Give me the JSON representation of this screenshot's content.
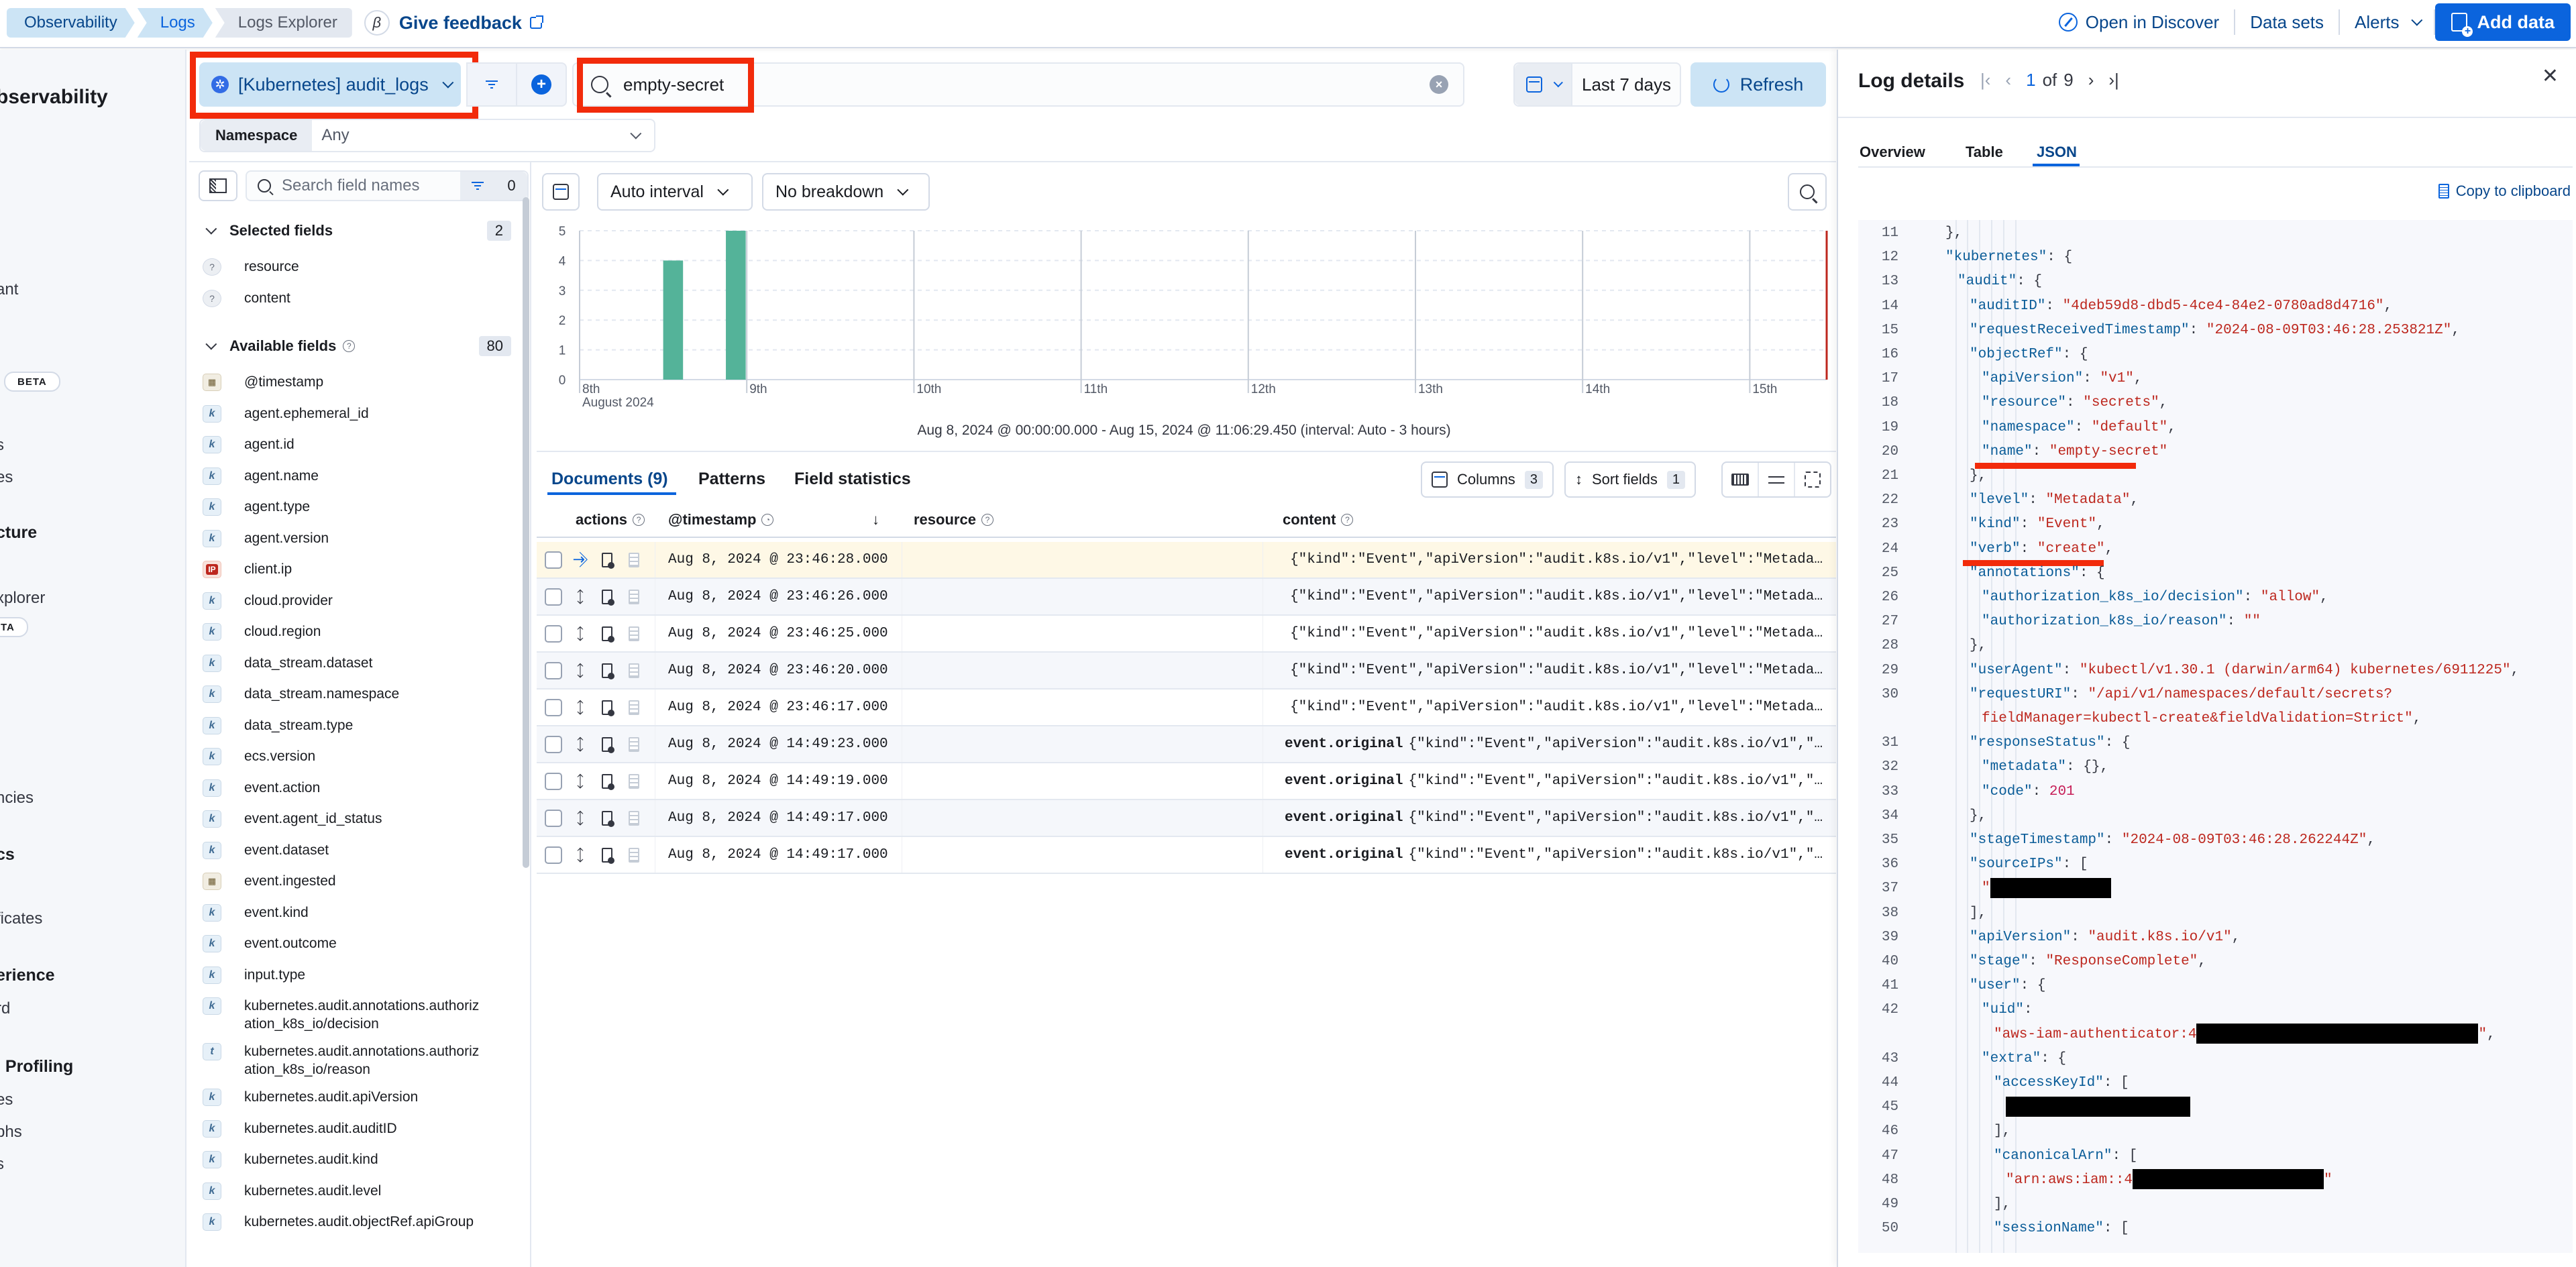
{
  "header": {
    "breadcrumbs": [
      "Observability",
      "Logs",
      "Logs Explorer"
    ],
    "beta_glyph": "β",
    "feedback_label": "Give feedback",
    "open_in_discover": "Open in Discover",
    "data_sets": "Data sets",
    "alerts": "Alerts",
    "add_data": "Add data"
  },
  "leftnav": {
    "title_fragment": "bservability",
    "fragments": [
      {
        "text": "ant",
        "bold": false
      },
      {
        "text": "BETA",
        "badge": true
      },
      {
        "text": "s",
        "bold": false
      },
      {
        "text": "es",
        "bold": false
      },
      {
        "text": "cture",
        "bold": true
      },
      {
        "text": "xplorer",
        "bold": false
      },
      {
        "text": "ETA",
        "badge": true
      },
      {
        "text": "ncies",
        "bold": false
      },
      {
        "text": "cs",
        "bold": true
      },
      {
        "text": "ficates",
        "bold": false
      },
      {
        "text": "erience",
        "bold": true
      },
      {
        "text": "rd",
        "bold": false
      },
      {
        "text": "l Profiling",
        "bold": true
      },
      {
        "text": "es",
        "bold": false
      },
      {
        "text": "phs",
        "bold": false
      },
      {
        "text": "s",
        "bold": false
      }
    ]
  },
  "querybar": {
    "dataview": "[Kubernetes] audit_logs",
    "query": "empty-secret",
    "date_range": "Last 7 days",
    "refresh": "Refresh",
    "namespace_label": "Namespace",
    "namespace_value": "Any"
  },
  "fields": {
    "search_placeholder": "Search field names",
    "filter_count": "0",
    "selected_title": "Selected fields",
    "selected_count": "2",
    "selected": [
      {
        "type": "unknown",
        "name": "resource"
      },
      {
        "type": "unknown",
        "name": "content"
      }
    ],
    "available_title": "Available fields",
    "available_count": "80",
    "available": [
      {
        "type": "date",
        "name": "@timestamp"
      },
      {
        "type": "keyword",
        "name": "agent.ephemeral_id"
      },
      {
        "type": "keyword",
        "name": "agent.id"
      },
      {
        "type": "keyword",
        "name": "agent.name"
      },
      {
        "type": "keyword",
        "name": "agent.type"
      },
      {
        "type": "keyword",
        "name": "agent.version"
      },
      {
        "type": "ip",
        "name": "client.ip"
      },
      {
        "type": "keyword",
        "name": "cloud.provider"
      },
      {
        "type": "keyword",
        "name": "cloud.region"
      },
      {
        "type": "keyword",
        "name": "data_stream.dataset"
      },
      {
        "type": "keyword",
        "name": "data_stream.namespace"
      },
      {
        "type": "keyword",
        "name": "data_stream.type"
      },
      {
        "type": "keyword",
        "name": "ecs.version"
      },
      {
        "type": "keyword",
        "name": "event.action"
      },
      {
        "type": "keyword",
        "name": "event.agent_id_status"
      },
      {
        "type": "keyword",
        "name": "event.dataset"
      },
      {
        "type": "date",
        "name": "event.ingested"
      },
      {
        "type": "keyword",
        "name": "event.kind"
      },
      {
        "type": "keyword",
        "name": "event.outcome"
      },
      {
        "type": "keyword",
        "name": "input.type"
      },
      {
        "type": "keyword",
        "name": "kubernetes.audit.annotations.authorization_k8s_io/decision"
      },
      {
        "type": "text",
        "name": "kubernetes.audit.annotations.authorization_k8s_io/reason"
      },
      {
        "type": "keyword",
        "name": "kubernetes.audit.apiVersion"
      },
      {
        "type": "keyword",
        "name": "kubernetes.audit.auditID"
      },
      {
        "type": "keyword",
        "name": "kubernetes.audit.kind"
      },
      {
        "type": "keyword",
        "name": "kubernetes.audit.level"
      },
      {
        "type": "keyword",
        "name": "kubernetes.audit.objectRef.apiGroup"
      }
    ]
  },
  "histogram": {
    "interval_label": "Auto interval",
    "breakdown_label": "No breakdown",
    "caption": "Aug 8, 2024 @ 00:00:00.000 - Aug 15, 2024 @ 11:06:29.450 (interval: Auto - 3 hours)"
  },
  "chart_data": {
    "type": "bar",
    "title": "",
    "xlabel": "",
    "ylabel": "",
    "ylim": [
      0,
      5
    ],
    "yticks": [
      "0",
      "1",
      "2",
      "3",
      "4",
      "5"
    ],
    "x_range_days": [
      8,
      15.46
    ],
    "x_ticks": [
      {
        "day": 8,
        "label": "8th",
        "sublabel": "August 2024"
      },
      {
        "day": 9,
        "label": "9th"
      },
      {
        "day": 10,
        "label": "10th"
      },
      {
        "day": 11,
        "label": "11th"
      },
      {
        "day": 12,
        "label": "12th"
      },
      {
        "day": 13,
        "label": "13th"
      },
      {
        "day": 14,
        "label": "14th"
      },
      {
        "day": 15,
        "label": "15th"
      }
    ],
    "interval_hours": 3,
    "bars": [
      {
        "bucket_start": "Aug 8, 2024 12:00",
        "day_offset": 8.5,
        "value": 4
      },
      {
        "bucket_start": "Aug 8, 2024 21:00",
        "day_offset": 8.875,
        "value": 5
      }
    ],
    "now_marker_day": 15.46,
    "bar_color": "#54b399",
    "grid": true
  },
  "documents": {
    "tabs": [
      "Documents (9)",
      "Patterns",
      "Field statistics"
    ],
    "columns_label": "Columns",
    "columns_count": "3",
    "sort_label": "Sort fields",
    "sort_count": "1",
    "headers": {
      "actions": "actions",
      "timestamp": "@timestamp",
      "resource": "resource",
      "content": "content"
    },
    "rows": [
      {
        "timestamp": "Aug 8, 2024 @ 23:46:28.000",
        "content_key": "",
        "content": "{\"kind\":\"Event\",\"apiVersion\":\"audit.k8s.io/v1\",\"level\":\"Metada…",
        "selected": true
      },
      {
        "timestamp": "Aug 8, 2024 @ 23:46:26.000",
        "content_key": "",
        "content": "{\"kind\":\"Event\",\"apiVersion\":\"audit.k8s.io/v1\",\"level\":\"Metada…"
      },
      {
        "timestamp": "Aug 8, 2024 @ 23:46:25.000",
        "content_key": "",
        "content": "{\"kind\":\"Event\",\"apiVersion\":\"audit.k8s.io/v1\",\"level\":\"Metada…"
      },
      {
        "timestamp": "Aug 8, 2024 @ 23:46:20.000",
        "content_key": "",
        "content": "{\"kind\":\"Event\",\"apiVersion\":\"audit.k8s.io/v1\",\"level\":\"Metada…"
      },
      {
        "timestamp": "Aug 8, 2024 @ 23:46:17.000",
        "content_key": "",
        "content": "{\"kind\":\"Event\",\"apiVersion\":\"audit.k8s.io/v1\",\"level\":\"Metada…"
      },
      {
        "timestamp": "Aug 8, 2024 @ 14:49:23.000",
        "content_key": "event.original",
        "content": "{\"kind\":\"Event\",\"apiVersion\":\"audit.k8s.io/v1\",\"…"
      },
      {
        "timestamp": "Aug 8, 2024 @ 14:49:19.000",
        "content_key": "event.original",
        "content": "{\"kind\":\"Event\",\"apiVersion\":\"audit.k8s.io/v1\",\"…"
      },
      {
        "timestamp": "Aug 8, 2024 @ 14:49:17.000",
        "content_key": "event.original",
        "content": "{\"kind\":\"Event\",\"apiVersion\":\"audit.k8s.io/v1\",\"…"
      },
      {
        "timestamp": "Aug 8, 2024 @ 14:49:17.000",
        "content_key": "event.original",
        "content": "{\"kind\":\"Event\",\"apiVersion\":\"audit.k8s.io/v1\",\"…"
      }
    ]
  },
  "flyout": {
    "title": "Log details",
    "page_current": "1",
    "page_of": "of",
    "page_total": "9",
    "tabs": [
      "Overview",
      "Table",
      "JSON"
    ],
    "active_tab": "JSON",
    "copy_label": "Copy to clipboard",
    "json_lines": [
      {
        "n": "11",
        "indent": 1,
        "parts": [
          [
            "p",
            "},"
          ]
        ]
      },
      {
        "n": "12",
        "indent": 1,
        "parts": [
          [
            "k",
            "\"kubernetes\""
          ],
          [
            "p",
            ": {"
          ]
        ]
      },
      {
        "n": "13",
        "indent": 2,
        "parts": [
          [
            "k",
            "\"audit\""
          ],
          [
            "p",
            ": {"
          ]
        ]
      },
      {
        "n": "14",
        "indent": 3,
        "parts": [
          [
            "k",
            "\"auditID\""
          ],
          [
            "p",
            ": "
          ],
          [
            "s",
            "\"4deb59d8-dbd5-4ce4-84e2-0780ad8d4716\""
          ],
          [
            "p",
            ","
          ]
        ]
      },
      {
        "n": "15",
        "indent": 3,
        "parts": [
          [
            "k",
            "\"requestReceivedTimestamp\""
          ],
          [
            "p",
            ": "
          ],
          [
            "s",
            "\"2024-08-09T03:46:28.253821Z\""
          ],
          [
            "p",
            ","
          ]
        ]
      },
      {
        "n": "16",
        "indent": 3,
        "parts": [
          [
            "k",
            "\"objectRef\""
          ],
          [
            "p",
            ": {"
          ]
        ]
      },
      {
        "n": "17",
        "indent": 4,
        "parts": [
          [
            "k",
            "\"apiVersion\""
          ],
          [
            "p",
            ": "
          ],
          [
            "s",
            "\"v1\""
          ],
          [
            "p",
            ","
          ]
        ]
      },
      {
        "n": "18",
        "indent": 4,
        "parts": [
          [
            "k",
            "\"resource\""
          ],
          [
            "p",
            ": "
          ],
          [
            "s",
            "\"secrets\""
          ],
          [
            "p",
            ","
          ]
        ]
      },
      {
        "n": "19",
        "indent": 4,
        "parts": [
          [
            "k",
            "\"namespace\""
          ],
          [
            "p",
            ": "
          ],
          [
            "s",
            "\"default\""
          ],
          [
            "p",
            ","
          ]
        ]
      },
      {
        "n": "20",
        "indent": 4,
        "parts": [
          [
            "k",
            "\"name\""
          ],
          [
            "p",
            ": "
          ],
          [
            "s",
            "\"empty-secret\""
          ]
        ],
        "highlight": true
      },
      {
        "n": "21",
        "indent": 3,
        "parts": [
          [
            "p",
            "},"
          ]
        ]
      },
      {
        "n": "22",
        "indent": 3,
        "parts": [
          [
            "k",
            "\"level\""
          ],
          [
            "p",
            ": "
          ],
          [
            "s",
            "\"Metadata\""
          ],
          [
            "p",
            ","
          ]
        ]
      },
      {
        "n": "23",
        "indent": 3,
        "parts": [
          [
            "k",
            "\"kind\""
          ],
          [
            "p",
            ": "
          ],
          [
            "s",
            "\"Event\""
          ],
          [
            "p",
            ","
          ]
        ]
      },
      {
        "n": "24",
        "indent": 3,
        "parts": [
          [
            "k",
            "\"verb\""
          ],
          [
            "p",
            ": "
          ],
          [
            "s",
            "\"create\""
          ],
          [
            "p",
            ","
          ]
        ],
        "highlight": true
      },
      {
        "n": "25",
        "indent": 3,
        "parts": [
          [
            "k",
            "\"annotations\""
          ],
          [
            "p",
            ": {"
          ]
        ]
      },
      {
        "n": "26",
        "indent": 4,
        "parts": [
          [
            "k",
            "\"authorization_k8s_io/decision\""
          ],
          [
            "p",
            ": "
          ],
          [
            "s",
            "\"allow\""
          ],
          [
            "p",
            ","
          ]
        ]
      },
      {
        "n": "27",
        "indent": 4,
        "parts": [
          [
            "k",
            "\"authorization_k8s_io/reason\""
          ],
          [
            "p",
            ": "
          ],
          [
            "s",
            "\"\""
          ]
        ]
      },
      {
        "n": "28",
        "indent": 3,
        "parts": [
          [
            "p",
            "},"
          ]
        ]
      },
      {
        "n": "29",
        "indent": 3,
        "parts": [
          [
            "k",
            "\"userAgent\""
          ],
          [
            "p",
            ": "
          ],
          [
            "s",
            "\"kubectl/v1.30.1 (darwin/arm64) kubernetes/6911225\""
          ],
          [
            "p",
            ","
          ]
        ]
      },
      {
        "n": "30",
        "indent": 3,
        "parts": [
          [
            "k",
            "\"requestURI\""
          ],
          [
            "p",
            ": "
          ],
          [
            "s",
            "\"/api/v1/namespaces/default/secrets?"
          ]
        ]
      },
      {
        "n": "",
        "indent": 4,
        "parts": [
          [
            "s",
            "fieldManager=kubectl-create&fieldValidation=Strict\""
          ],
          [
            "p",
            ","
          ]
        ]
      },
      {
        "n": "31",
        "indent": 3,
        "parts": [
          [
            "k",
            "\"responseStatus\""
          ],
          [
            "p",
            ": {"
          ]
        ]
      },
      {
        "n": "32",
        "indent": 4,
        "parts": [
          [
            "k",
            "\"metadata\""
          ],
          [
            "p",
            ": {},"
          ]
        ]
      },
      {
        "n": "33",
        "indent": 4,
        "parts": [
          [
            "k",
            "\"code\""
          ],
          [
            "p",
            ": "
          ],
          [
            "n",
            "201"
          ]
        ]
      },
      {
        "n": "34",
        "indent": 3,
        "parts": [
          [
            "p",
            "},"
          ]
        ]
      },
      {
        "n": "35",
        "indent": 3,
        "parts": [
          [
            "k",
            "\"stageTimestamp\""
          ],
          [
            "p",
            ": "
          ],
          [
            "s",
            "\"2024-08-09T03:46:28.262244Z\""
          ],
          [
            "p",
            ","
          ]
        ]
      },
      {
        "n": "36",
        "indent": 3,
        "parts": [
          [
            "k",
            "\"sourceIPs\""
          ],
          [
            "p",
            ": ["
          ]
        ]
      },
      {
        "n": "37",
        "indent": 4,
        "parts": [
          [
            "s",
            "\""
          ],
          [
            "redact",
            "180"
          ]
        ]
      },
      {
        "n": "38",
        "indent": 3,
        "parts": [
          [
            "p",
            "],"
          ]
        ]
      },
      {
        "n": "39",
        "indent": 3,
        "parts": [
          [
            "k",
            "\"apiVersion\""
          ],
          [
            "p",
            ": "
          ],
          [
            "s",
            "\"audit.k8s.io/v1\""
          ],
          [
            "p",
            ","
          ]
        ]
      },
      {
        "n": "40",
        "indent": 3,
        "parts": [
          [
            "k",
            "\"stage\""
          ],
          [
            "p",
            ": "
          ],
          [
            "s",
            "\"ResponseComplete\""
          ],
          [
            "p",
            ","
          ]
        ]
      },
      {
        "n": "41",
        "indent": 3,
        "parts": [
          [
            "k",
            "\"user\""
          ],
          [
            "p",
            ": {"
          ]
        ]
      },
      {
        "n": "42",
        "indent": 4,
        "parts": [
          [
            "k",
            "\"uid\""
          ],
          [
            "p",
            ":"
          ]
        ]
      },
      {
        "n": "",
        "indent": 5,
        "parts": [
          [
            "s",
            "\"aws-iam-authenticator:4"
          ],
          [
            "redact",
            "420"
          ],
          [
            "s",
            "\""
          ],
          [
            "p",
            ","
          ]
        ]
      },
      {
        "n": "43",
        "indent": 4,
        "parts": [
          [
            "k",
            "\"extra\""
          ],
          [
            "p",
            ": {"
          ]
        ]
      },
      {
        "n": "44",
        "indent": 5,
        "parts": [
          [
            "k",
            "\"accessKeyId\""
          ],
          [
            "p",
            ": ["
          ]
        ]
      },
      {
        "n": "45",
        "indent": 6,
        "parts": [
          [
            "redact",
            "275"
          ]
        ]
      },
      {
        "n": "46",
        "indent": 5,
        "parts": [
          [
            "p",
            "],"
          ]
        ]
      },
      {
        "n": "47",
        "indent": 5,
        "parts": [
          [
            "k",
            "\"canonicalArn\""
          ],
          [
            "p",
            ": ["
          ]
        ]
      },
      {
        "n": "48",
        "indent": 6,
        "parts": [
          [
            "s",
            "\"arn:aws:iam::4"
          ],
          [
            "redact",
            "285"
          ],
          [
            "s",
            "\""
          ]
        ]
      },
      {
        "n": "49",
        "indent": 5,
        "parts": [
          [
            "p",
            "],"
          ]
        ]
      },
      {
        "n": "50",
        "indent": 5,
        "parts": [
          [
            "k",
            "\"sessionName\""
          ],
          [
            "p",
            ": ["
          ]
        ]
      }
    ]
  },
  "colors": {
    "accent": "#0b64dd",
    "annotation_red": "#f22b0b",
    "bar": "#54b399",
    "json_key": "#0a5c98",
    "json_string": "#bd271e"
  }
}
